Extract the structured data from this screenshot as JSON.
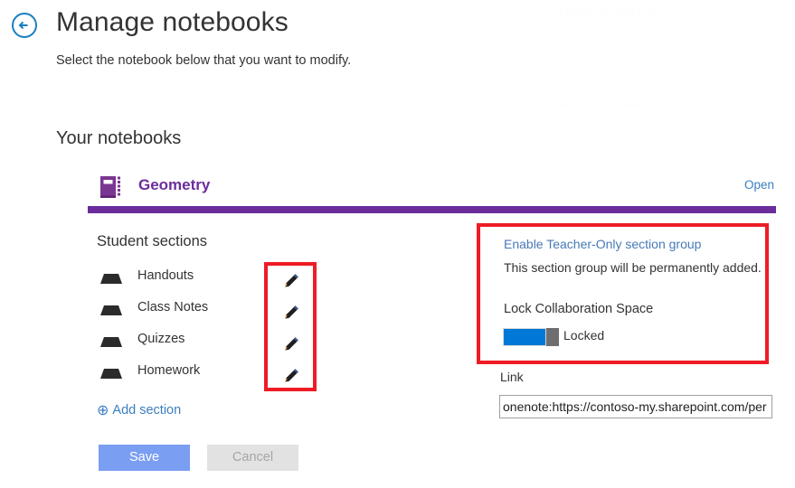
{
  "header": {
    "back_icon": "back-arrow-circle-icon",
    "title": "Manage notebooks",
    "subtitle": "Select the notebook below that you want to modify."
  },
  "notebooks_section": {
    "heading": "Your notebooks",
    "notebook": {
      "icon": "notebook-book-icon",
      "name": "Geometry",
      "open_label": "Open",
      "accent_color": "#6b2d9b"
    }
  },
  "student_sections": {
    "heading": "Student sections",
    "items": [
      {
        "label": "Handouts",
        "icon": "section-tab-icon",
        "edit_icon": "pencil-icon"
      },
      {
        "label": "Class Notes",
        "icon": "section-tab-icon",
        "edit_icon": "pencil-icon"
      },
      {
        "label": "Quizzes",
        "icon": "section-tab-icon",
        "edit_icon": "pencil-icon"
      },
      {
        "label": "Homework",
        "icon": "section-tab-icon",
        "edit_icon": "pencil-icon"
      }
    ],
    "add_section": {
      "icon": "plus-circle-icon",
      "label": "Add section"
    }
  },
  "buttons": {
    "save": "Save",
    "cancel": "Cancel",
    "save_color": "#7a9ef2",
    "cancel_color": "#e2e2e2"
  },
  "right_panel": {
    "teacher_only_link": "Enable Teacher-Only section group",
    "teacher_only_desc": "This section group will be permanently added.",
    "lock_label": "Lock Collaboration Space",
    "toggle_state": "Locked",
    "toggle_on_color": "#0078d7"
  },
  "link_field": {
    "label": "Link",
    "value": "onenote:https://contoso-my.sharepoint.com/per",
    "placeholder": "onenote:https://"
  },
  "highlights": {
    "pencil_box_color": "#ee1c25",
    "right_box_color": "#ee1c25"
  },
  "watermarks": {
    "line1": "Microsoft OneNote",
    "line2": "Microsoft OneNote"
  }
}
